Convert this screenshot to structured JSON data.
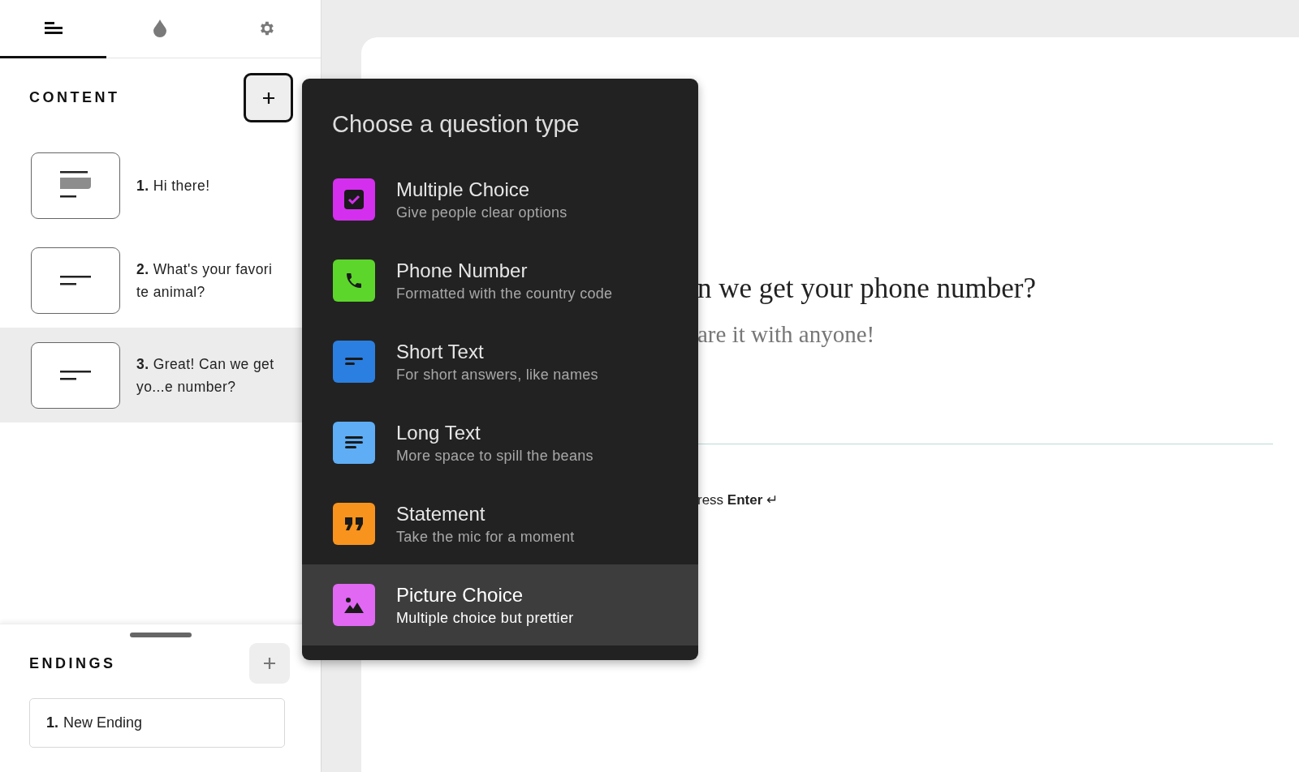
{
  "sidebar_tabs": [
    {
      "kind": "content",
      "selected": true
    },
    {
      "kind": "design",
      "selected": false
    },
    {
      "kind": "settings",
      "selected": false
    }
  ],
  "content": {
    "heading": "CONTENT",
    "items": [
      {
        "number": "1.",
        "text": "Hi there!",
        "kind": "welcome",
        "selected": false
      },
      {
        "number": "2.",
        "text": "What's your favorite animal?",
        "kind": "short",
        "selected": false
      },
      {
        "number": "3.",
        "text": "Great! Can we get yo...e number?",
        "kind": "short",
        "selected": true
      }
    ]
  },
  "endings": {
    "heading": "ENDINGS",
    "items": [
      {
        "number": "1.",
        "text": "New Ending"
      }
    ]
  },
  "canvas": {
    "question": "n we get your phone number?",
    "description": "are it with anyone!",
    "hint": "ress **Enter** ↵"
  },
  "question_type_menu": {
    "title": "Choose a question type",
    "items": [
      {
        "kind": "checkbox",
        "color": "#d42fef",
        "title": "Multiple Choice",
        "subtitle": "Give people clear options",
        "selected": false
      },
      {
        "kind": "phone",
        "color": "#5cd62b",
        "title": "Phone Number",
        "subtitle": "Formatted with the country code",
        "selected": false
      },
      {
        "kind": "short",
        "color": "#2b7fe0",
        "title": "Short Text",
        "subtitle": "For short answers, like names",
        "selected": false
      },
      {
        "kind": "long",
        "color": "#5eadf5",
        "title": "Long Text",
        "subtitle": "More space to spill the beans",
        "selected": false
      },
      {
        "kind": "quote",
        "color": "#f8931d",
        "title": "Statement",
        "subtitle": "Take the mic for a moment",
        "selected": false
      },
      {
        "kind": "image",
        "color": "#e068f3",
        "title": "Picture Choice",
        "subtitle": "Multiple choice but prettier",
        "selected": true
      }
    ]
  }
}
